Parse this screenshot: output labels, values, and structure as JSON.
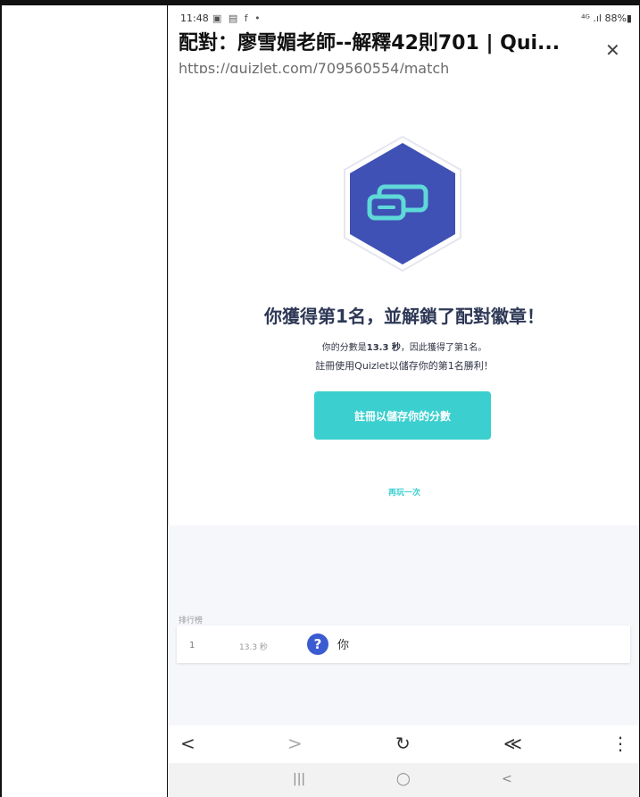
{
  "status_bar": {
    "time": "11:48",
    "notification_icons": "▣ ▤ f •",
    "signal": "⁴ᴳ .ıl",
    "battery": "88%▮"
  },
  "page": {
    "title": "配對：廖雪媚老師--解釋42則701 | Qui...",
    "url": "https://quizlet.com/709560554/match"
  },
  "result": {
    "headline": "你獲得第1名，並解鎖了配對徽章！",
    "score_prefix": "你的分數是",
    "score_value": "13.3 秒",
    "score_suffix": "，因此獲得了第1名。",
    "save_hint": "註冊使用Quizlet以儲存你的第1名勝利！",
    "signup_button": "註冊以儲存你的分數",
    "replay_link": "再玩一次"
  },
  "leaderboard": {
    "label": "排行榜",
    "rows": [
      {
        "rank": "1",
        "time": "13.3 秒",
        "avatar": "?",
        "name": "你"
      }
    ]
  },
  "browser_nav": {
    "back": "<",
    "forward": ">",
    "reload": "↻",
    "share": "≪",
    "menu": "⋮"
  },
  "system_nav": {
    "recents": "|||",
    "home": "◯",
    "back": "<"
  },
  "colors": {
    "accent": "#3ccfcf",
    "badge_fill": "#3f51b5",
    "badge_border": "#ffffff",
    "headline": "#2e3856",
    "avatar": "#3b5bd1"
  }
}
